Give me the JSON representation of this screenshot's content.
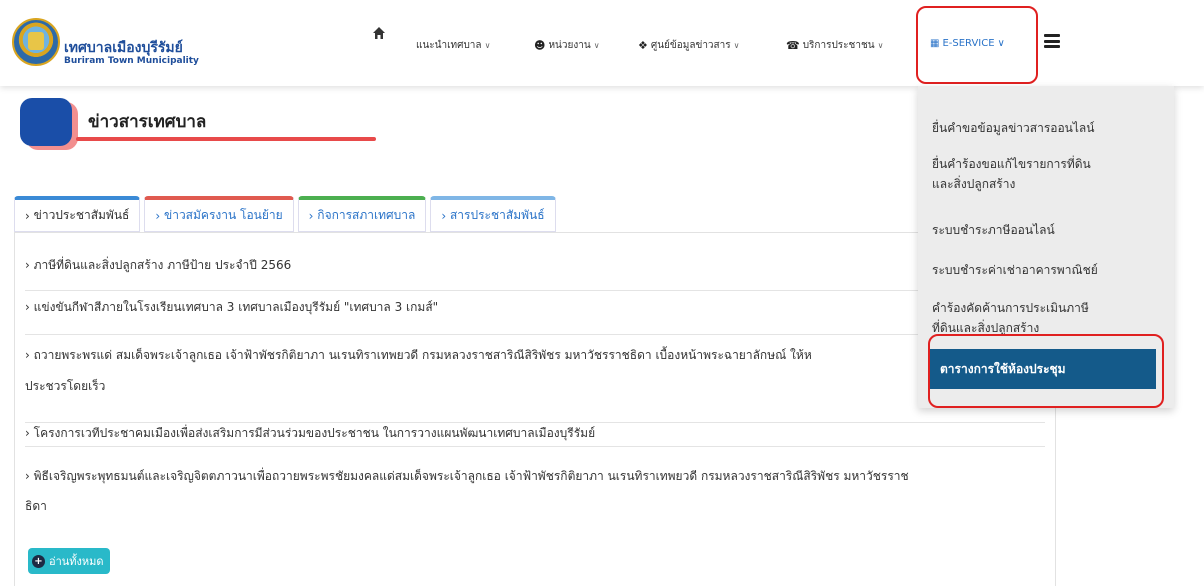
{
  "brand": {
    "name_th": "เทศบาลเมืองบุรีรัมย์",
    "name_en": "Buriram Town Municipality"
  },
  "nav": {
    "home_icon": "home-icon",
    "items": [
      {
        "label": "แนะนำเทศบาล",
        "icon": ""
      },
      {
        "label": "หน่วยงาน",
        "icon": "user-circle-icon"
      },
      {
        "label": "ศูนย์ข้อมูลข่าวสาร",
        "icon": "info-circle-icon"
      },
      {
        "label": "บริการประชาชน",
        "icon": "phone-icon"
      }
    ],
    "eservice": {
      "label": "E-SERVICE",
      "icon": "grid-icon"
    },
    "menu_icon": "hamburger-icon"
  },
  "section": {
    "title": "ข่าวสารเทศบาล"
  },
  "tabs": [
    {
      "label": "ข่าวประชาสัมพันธ์",
      "color": "#3a8ad6",
      "active": true
    },
    {
      "label": "ข่าวสมัครงาน โอนย้าย",
      "color": "#e05a50",
      "active": false
    },
    {
      "label": "กิจการสภาเทศบาล",
      "color": "#4caf50",
      "active": false
    },
    {
      "label": "สารประชาสัมพันธ์",
      "color": "#7fb6e6",
      "active": false
    }
  ],
  "news": [
    {
      "text": "ภาษีที่ดินและสิ่งปลูกสร้าง ภาษีป้าย ประจำปี 2566"
    },
    {
      "text": "แข่งขันกีฬาสีภายในโรงเรียนเทศบาล 3 เทศบาลเมืองบุรีรัมย์ \"เทศบาล 3 เกมส์\""
    },
    {
      "text": "ถวายพระพรแด่ สมเด็จพระเจ้าลูกเธอ เจ้าฟ้าพัชรกิติยาภา นเรนทิราเทพยวดี กรมหลวงราชสาริณีสิริพัชร มหาวัชรราชธิดา เบื้องหน้าพระฉายาลักษณ์ ให้ห",
      "text2": "ประชวรโดยเร็ว"
    },
    {
      "text": "โครงการเวทีประชาคมเมืองเพื่อส่งเสริมการมีส่วนร่วมของประชาชน ในการวางแผนพัฒนาเทศบาลเมืองบุรีรัมย์"
    },
    {
      "text": "พิธีเจริญพระพุทธมนต์และเจริญจิตตภาวนาเพื่อถวายพระพรชัยมงคลแด่สมเด็จพระเจ้าลูกเธอ เจ้าฟ้าพัชรกิติยาภา นเรนทิราเทพยวดี กรมหลวงราชสาริณีสิริพัชร มหาวัชรราช",
      "text2": "ธิดา"
    }
  ],
  "read_all": {
    "label": "อ่านทั้งหมด"
  },
  "dropdown": {
    "items": [
      {
        "label": "ยื่นคำขอข้อมูลข่าวสารออนไลน์"
      },
      {
        "label": "ยื่นคำร้องขอแก้ไขรายการที่ดิน",
        "label2": "และสิ่งปลูกสร้าง"
      },
      {
        "label": "ระบบชำระภาษีออนไลน์"
      },
      {
        "label": "ระบบชำระค่าเช่าอาคารพาณิชย์"
      },
      {
        "label": "คำร้องคัดค้านการประเมินภาษี",
        "label2": "ที่ดินและสิ่งปลูกสร้าง"
      },
      {
        "label": "ตารางการใช้ห้องประชุม",
        "selected": true
      }
    ]
  },
  "colors": {
    "accent_blue": "#1a4ea8",
    "highlight_red": "#e02020",
    "selected_item": "#145a8a",
    "read_all_bg": "#29b9c9"
  }
}
